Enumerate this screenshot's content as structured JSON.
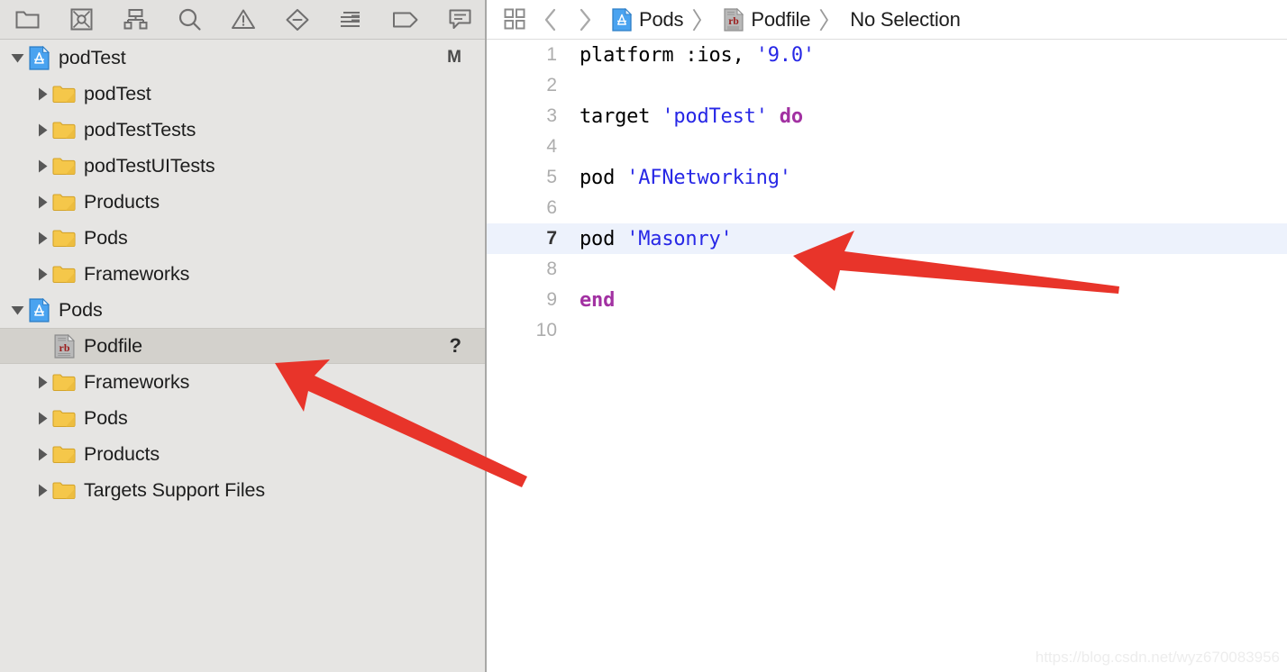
{
  "navigator": {
    "toolbar": [
      {
        "name": "project-navigator-icon",
        "label": "Project"
      },
      {
        "name": "source-control-navigator-icon",
        "label": "Source Control"
      },
      {
        "name": "symbol-navigator-icon",
        "label": "Symbol"
      },
      {
        "name": "find-navigator-icon",
        "label": "Find"
      },
      {
        "name": "issue-navigator-icon",
        "label": "Issue"
      },
      {
        "name": "test-navigator-icon",
        "label": "Test"
      },
      {
        "name": "report-navigator-icon",
        "label": "Report"
      },
      {
        "name": "breakpoint-navigator-icon",
        "label": "Breakpoint"
      },
      {
        "name": "debug-navigator-icon",
        "label": "Debug"
      }
    ],
    "tree": [
      {
        "label": "podTest",
        "icon": "xcode-project-icon",
        "indent": 0,
        "disclosure": "open",
        "badge": "M",
        "selected": false
      },
      {
        "label": "podTest",
        "icon": "folder-icon",
        "indent": 1,
        "disclosure": "closed",
        "badge": "",
        "selected": false
      },
      {
        "label": "podTestTests",
        "icon": "folder-icon",
        "indent": 1,
        "disclosure": "closed",
        "badge": "",
        "selected": false
      },
      {
        "label": "podTestUITests",
        "icon": "folder-icon",
        "indent": 1,
        "disclosure": "closed",
        "badge": "",
        "selected": false
      },
      {
        "label": "Products",
        "icon": "folder-icon",
        "indent": 1,
        "disclosure": "closed",
        "badge": "",
        "selected": false
      },
      {
        "label": "Pods",
        "icon": "folder-icon",
        "indent": 1,
        "disclosure": "closed",
        "badge": "",
        "selected": false
      },
      {
        "label": "Frameworks",
        "icon": "folder-icon",
        "indent": 1,
        "disclosure": "closed",
        "badge": "",
        "selected": false
      },
      {
        "label": "Pods",
        "icon": "xcode-project-icon",
        "indent": 0,
        "disclosure": "open",
        "badge": "",
        "selected": false
      },
      {
        "label": "Podfile",
        "icon": "ruby-file-icon",
        "indent": 1,
        "disclosure": "none",
        "badge": "?",
        "selected": true
      },
      {
        "label": "Frameworks",
        "icon": "folder-icon",
        "indent": 1,
        "disclosure": "closed",
        "badge": "",
        "selected": false
      },
      {
        "label": "Pods",
        "icon": "folder-icon",
        "indent": 1,
        "disclosure": "closed",
        "badge": "",
        "selected": false
      },
      {
        "label": "Products",
        "icon": "folder-icon",
        "indent": 1,
        "disclosure": "closed",
        "badge": "",
        "selected": false
      },
      {
        "label": "Targets Support Files",
        "icon": "folder-icon",
        "indent": 1,
        "disclosure": "closed",
        "badge": "",
        "selected": false
      }
    ]
  },
  "editor": {
    "jump_bar": {
      "related_items_icon": "related-items-grid-icon",
      "back_label": "‹",
      "forward_label": "›",
      "breadcrumbs": [
        {
          "label": "Pods",
          "icon": "xcode-project-icon"
        },
        {
          "label": "Podfile",
          "icon": "ruby-file-icon"
        },
        {
          "label": "No Selection",
          "icon": "none"
        }
      ],
      "separator": "〉"
    },
    "highlighted_line": 7,
    "lines": [
      {
        "num": "1",
        "tokens": [
          {
            "t": "platform :ios, ",
            "c": "plain"
          },
          {
            "t": "'9.0'",
            "c": "str"
          }
        ]
      },
      {
        "num": "2",
        "tokens": []
      },
      {
        "num": "3",
        "tokens": [
          {
            "t": "target ",
            "c": "plain"
          },
          {
            "t": "'podTest'",
            "c": "str"
          },
          {
            "t": " ",
            "c": "plain"
          },
          {
            "t": "do",
            "c": "kw"
          }
        ]
      },
      {
        "num": "4",
        "tokens": []
      },
      {
        "num": "5",
        "tokens": [
          {
            "t": "pod ",
            "c": "plain"
          },
          {
            "t": "'AFNetworking'",
            "c": "str"
          }
        ]
      },
      {
        "num": "6",
        "tokens": []
      },
      {
        "num": "7",
        "tokens": [
          {
            "t": "pod ",
            "c": "plain"
          },
          {
            "t": "'Masonry'",
            "c": "str"
          }
        ]
      },
      {
        "num": "8",
        "tokens": []
      },
      {
        "num": "9",
        "tokens": [
          {
            "t": "end",
            "c": "kw"
          }
        ]
      },
      {
        "num": "10",
        "tokens": []
      }
    ]
  },
  "annotations": {
    "arrow_color": "#E8342A",
    "arrows": [
      {
        "name": "arrow-pointing-to-masonry-line",
        "points_to": "pod 'Masonry'"
      },
      {
        "name": "arrow-pointing-to-podfile",
        "points_to": "Podfile"
      }
    ]
  },
  "watermark": {
    "text": "https://blog.csdn.net/wyz670083956"
  }
}
